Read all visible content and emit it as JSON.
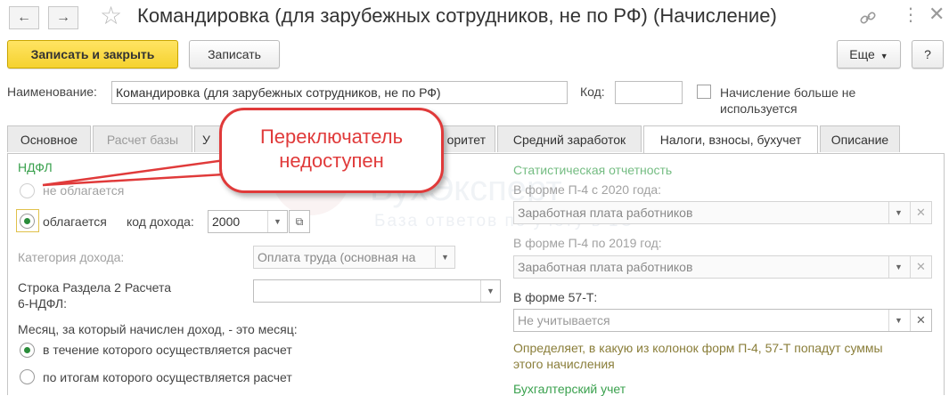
{
  "window": {
    "title": "Командировка (для зарубежных сотрудников, не по РФ) (Начисление)",
    "back_icon": "arrow-left-icon",
    "forward_icon": "arrow-right-icon",
    "favorite_icon": "star-icon",
    "link_icon": "link-icon",
    "menu_icon": "more-vertical-icon",
    "close_icon": "close-icon"
  },
  "toolbar": {
    "save_close_label": "Записать и закрыть",
    "save_label": "Записать",
    "more_label": "Еще",
    "help_label": "?"
  },
  "header": {
    "name_label": "Наименование:",
    "name_value": "Командировка (для зарубежных сотрудников, не по РФ)",
    "code_label": "Код:",
    "code_value": "",
    "inactive_label": "Начисление больше не используется",
    "inactive_label_line1": "Начисление больше не",
    "inactive_label_line2": "используется"
  },
  "tabs": [
    {
      "label": "Основное",
      "state": "normal"
    },
    {
      "label": "Расчет базы",
      "state": "inactive"
    },
    {
      "label": "У",
      "state": "normal"
    },
    {
      "label": "оритет",
      "state": "normal"
    },
    {
      "label": "Средний заработок",
      "state": "normal"
    },
    {
      "label": "Налоги, взносы, бухучет",
      "state": "active"
    },
    {
      "label": "Описание",
      "state": "normal"
    }
  ],
  "callout": {
    "line1": "Переключатель",
    "line2": "недоступен",
    "color": "#e03a3a"
  },
  "watermark": {
    "line1": "БухЭксперт",
    "line2": "База ответов по учету в 1С"
  },
  "ndfl": {
    "section_label": "НДФЛ",
    "not_taxed_label": "не облагается",
    "taxed_label": "облагается",
    "income_code_label": "код дохода:",
    "income_code_value": "2000",
    "income_category_label": "Категория дохода:",
    "income_category_value": "Оплата труда (основная на",
    "row_6ndfl_label_line1": "Строка Раздела 2 Расчета",
    "row_6ndfl_label_line2": "6-НДФЛ:",
    "row_6ndfl_value": "",
    "month_label": "Месяц, за который начислен доход, - это месяц:",
    "month_option1": "в течение которого осуществляется расчет",
    "month_option2": "по итогам которого осуществляется расчет"
  },
  "statistics": {
    "section_label": "Статистическая отчетность",
    "p4_2020_label": "В форме П-4 с 2020 года:",
    "p4_2020_value": "Заработная плата работников",
    "p4_2019_label": "В форме П-4 по 2019 год:",
    "p4_2019_value": "Заработная плата работников",
    "f57t_label": "В форме 57-Т:",
    "f57t_placeholder": "Не учитывается",
    "hint_line1": "Определяет, в какую из колонок форм П-4, 57-Т попадут суммы",
    "hint_line2": "этого начисления"
  },
  "accounting": {
    "section_label": "Бухгалтерский учет"
  },
  "colors": {
    "accent_green": "#3aa14e",
    "primary_button": "#f5d22f",
    "hint_text": "#8a7e3a"
  }
}
